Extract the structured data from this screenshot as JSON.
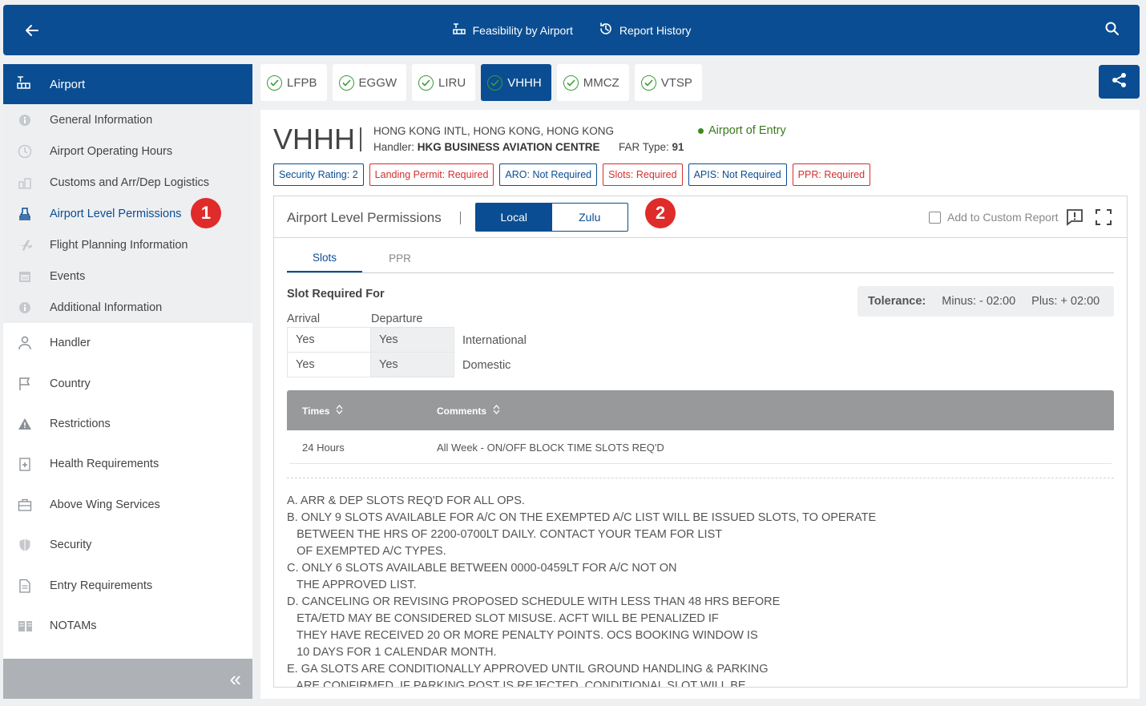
{
  "topbar": {
    "nav": [
      {
        "label": "Feasibility by Airport",
        "icon": "airport-icon"
      },
      {
        "label": "Report History",
        "icon": "history-icon"
      }
    ]
  },
  "sidebar": {
    "header": "Airport",
    "sub_items": [
      {
        "label": "General Information",
        "icon": "info-icon"
      },
      {
        "label": "Airport Operating Hours",
        "icon": "clock-icon"
      },
      {
        "label": "Customs and Arr/Dep Logistics",
        "icon": "customs-icon"
      },
      {
        "label": "Airport Level Permissions",
        "icon": "stamp-icon",
        "active": true
      },
      {
        "label": "Flight Planning Information",
        "icon": "plane-icon"
      },
      {
        "label": "Events",
        "icon": "calendar-icon"
      },
      {
        "label": "Additional Information",
        "icon": "info-icon"
      }
    ],
    "items": [
      {
        "label": "Handler",
        "icon": "person-icon"
      },
      {
        "label": "Country",
        "icon": "flag-icon"
      },
      {
        "label": "Restrictions",
        "icon": "warning-icon"
      },
      {
        "label": "Health Requirements",
        "icon": "health-icon"
      },
      {
        "label": "Above Wing Services",
        "icon": "briefcase-icon"
      },
      {
        "label": "Security",
        "icon": "shield-icon"
      },
      {
        "label": "Entry Requirements",
        "icon": "document-icon"
      },
      {
        "label": "NOTAMs",
        "icon": "book-icon"
      }
    ],
    "collapse": "«"
  },
  "callouts": {
    "one": "1",
    "two": "2"
  },
  "airport_tabs": [
    "LFPB",
    "EGGW",
    "LIRU",
    "VHHH",
    "MMCZ",
    "VTSP"
  ],
  "airport_tabs_active": "VHHH",
  "airport": {
    "code": "VHHH",
    "name": "HONG KONG INTL, HONG KONG, HONG KONG",
    "handler_label": "Handler:",
    "handler": "HKG BUSINESS AVIATION CENTRE",
    "far_label": "FAR Type:",
    "far": "91",
    "entry": "Airport of Entry"
  },
  "pills": [
    {
      "label": "Security Rating: 2",
      "color": "blue"
    },
    {
      "label": "Landing Permit: Required",
      "color": "red"
    },
    {
      "label": "ARO: Not Required",
      "color": "blue"
    },
    {
      "label": "Slots: Required",
      "color": "red"
    },
    {
      "label": "APIS: Not Required",
      "color": "blue"
    },
    {
      "label": "PPR: Required",
      "color": "red"
    }
  ],
  "panel": {
    "title": "Airport Level Permissions",
    "toggle": {
      "local": "Local",
      "zulu": "Zulu"
    },
    "custom_report": "Add to Custom Report",
    "subtabs": [
      "Slots",
      "PPR"
    ],
    "slot_required_for": "Slot Required For",
    "tolerance": {
      "label": "Tolerance:",
      "minus": "Minus: - 02:00",
      "plus": "Plus: + 02:00"
    },
    "arrival_header": "Arrival",
    "departure_header": "Departure",
    "rows": [
      {
        "arrival": "Yes",
        "departure": "Yes",
        "label": "International"
      },
      {
        "arrival": "Yes",
        "departure": "Yes",
        "label": "Domestic"
      }
    ],
    "table": {
      "col_times": "Times",
      "col_comments": "Comments",
      "rows": [
        {
          "times": "24 Hours",
          "comments": "All Week - ON/OFF BLOCK TIME SLOTS REQ'D"
        }
      ]
    },
    "notes": "A. ARR & DEP SLOTS REQ'D FOR ALL OPS.\nB. ONLY 9 SLOTS AVAILABLE FOR A/C ON THE EXEMPTED A/C LIST WILL BE ISSUED SLOTS, TO OPERATE\n   BETWEEN THE HRS OF 2200-0700LT DAILY. CONTACT YOUR TEAM FOR LIST\n   OF EXEMPTED A/C TYPES.\nC. ONLY 6 SLOTS AVAILABLE BETWEEN 0000-0459LT FOR A/C NOT ON\n   THE APPROVED LIST.\nD. CANCELING OR REVISING PROPOSED SCHEDULE WITH LESS THAN 48 HRS BEFORE\n   ETA/ETD MAY BE CONSIDERED SLOT MISUSE. ACFT WILL BE PENALIZED IF\n   THEY HAVE RECEIVED 20 OR MORE PENALTY POINTS. OCS BOOKING WINDOW IS\n   10 DAYS FOR 1 CALENDAR MONTH.\nE. GA SLOTS ARE CONDITIONALLY APPROVED UNTIL GROUND HANDLING & PARKING\n   ARE CONFIRMED. IF PARKING POST IS REJECTED, CONDITIONAL SLOT WILL BE"
  },
  "colors": {
    "brand": "#0a4d92",
    "required": "#d32f2f",
    "entry": "#3a7a1e",
    "check": "#3a9a3a"
  }
}
